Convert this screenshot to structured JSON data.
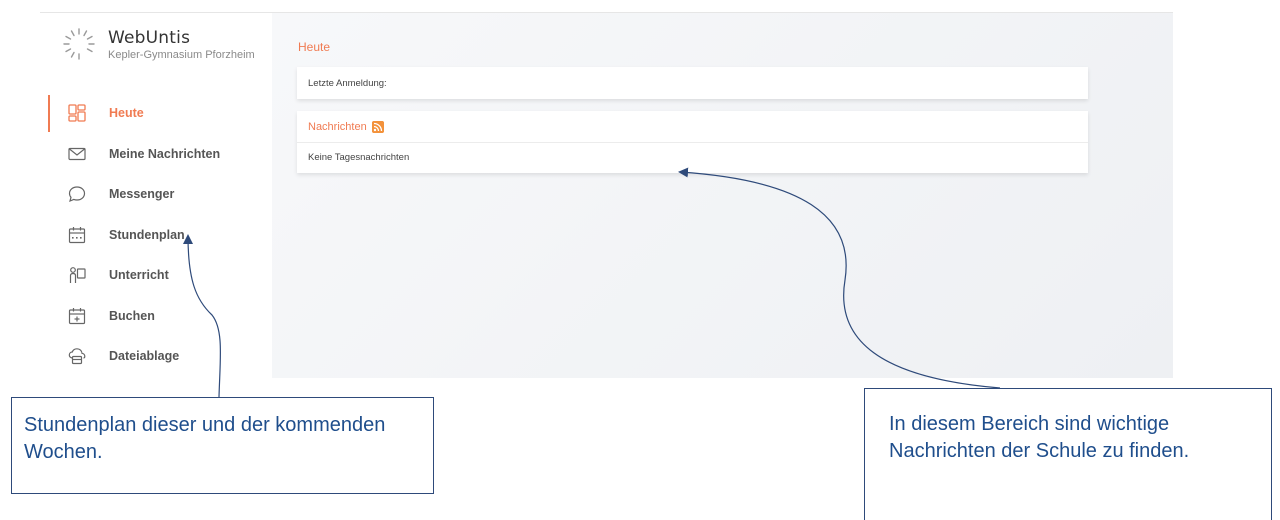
{
  "brand": {
    "name": "WebUntis",
    "school": "Kepler-Gymnasium Pforzheim"
  },
  "nav": [
    {
      "label": "Heute",
      "icon": "dashboard-icon",
      "active": true
    },
    {
      "label": "Meine Nachrichten",
      "icon": "envelope-icon"
    },
    {
      "label": "Messenger",
      "icon": "chat-bubble-icon"
    },
    {
      "label": "Stundenplan",
      "icon": "calendar-icon"
    },
    {
      "label": "Unterricht",
      "icon": "teacher-board-icon"
    },
    {
      "label": "Buchen",
      "icon": "calendar-plus-icon"
    },
    {
      "label": "Dateiablage",
      "icon": "cloud-folder-icon"
    }
  ],
  "main": {
    "title": "Heute",
    "login_label": "Letzte Anmeldung:",
    "news_title": "Nachrichten",
    "news_empty": "Keine Tagesnachrichten"
  },
  "callouts": {
    "left": "Stundenplan dieser und der kommenden Wochen.",
    "right": "In diesem Bereich sind wichtige Nachrichten der Schule zu finden."
  },
  "colors": {
    "accent": "#f07b52",
    "callout_text": "#1f4e8c",
    "arrow": "#2e4a7a"
  }
}
